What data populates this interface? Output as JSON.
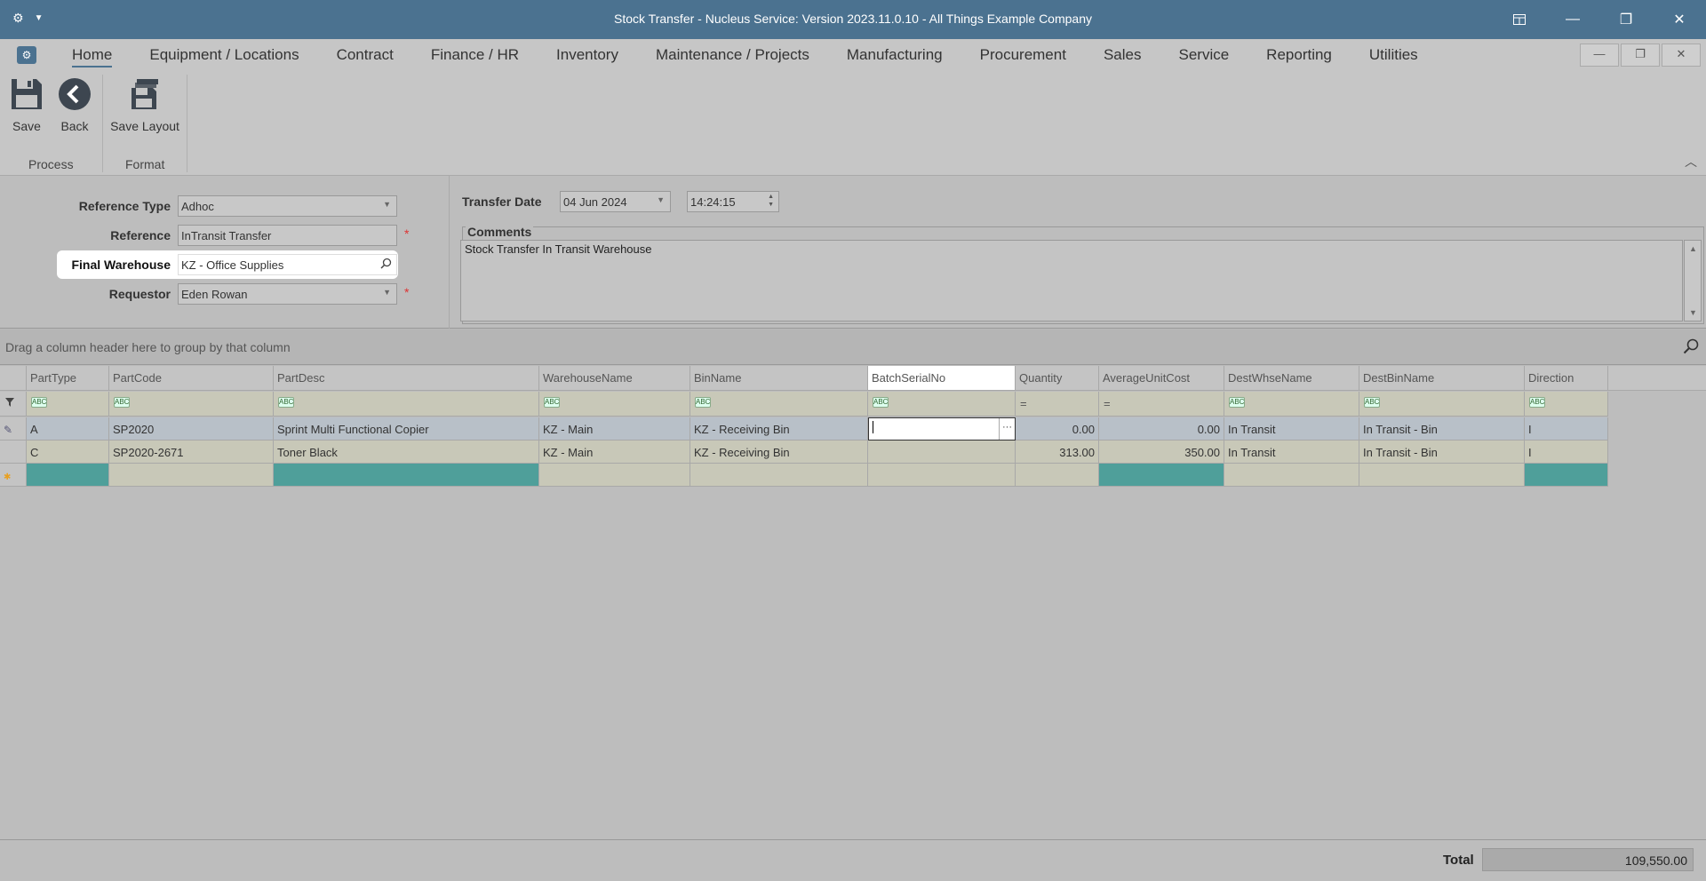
{
  "window": {
    "title": "Stock Transfer - Nucleus Service: Version 2023.11.0.10 - All Things Example Company"
  },
  "menu": {
    "tabs": [
      "Home",
      "Equipment / Locations",
      "Contract",
      "Finance / HR",
      "Inventory",
      "Maintenance / Projects",
      "Manufacturing",
      "Procurement",
      "Sales",
      "Service",
      "Reporting",
      "Utilities"
    ]
  },
  "ribbon": {
    "save_label": "Save",
    "back_label": "Back",
    "save_layout_label": "Save Layout",
    "group_process": "Process",
    "group_format": "Format"
  },
  "form": {
    "reference_type_label": "Reference Type",
    "reference_type_value": "Adhoc",
    "reference_label": "Reference",
    "reference_value": "InTransit Transfer",
    "final_warehouse_label": "Final Warehouse",
    "final_warehouse_value": "KZ - Office Supplies",
    "requestor_label": "Requestor",
    "requestor_value": "Eden Rowan",
    "required_mark": "*",
    "transfer_date_label": "Transfer Date",
    "transfer_date_value": "04 Jun 2024",
    "transfer_time_value": "14:24:15",
    "comments_label": "Comments",
    "comments_value": "Stock Transfer In Transit Warehouse"
  },
  "grid": {
    "group_hint": "Drag a column header here to group by that column",
    "columns": [
      "PartType",
      "PartCode",
      "PartDesc",
      "WarehouseName",
      "BinName",
      "BatchSerialNo",
      "Quantity",
      "AverageUnitCost",
      "DestWhseName",
      "DestBinName",
      "Direction"
    ],
    "rows": [
      {
        "PartType": "A",
        "PartCode": "SP2020",
        "PartDesc": "Sprint Multi Functional Copier",
        "WarehouseName": "KZ - Main",
        "BinName": "KZ - Receiving Bin",
        "BatchSerialNo": "",
        "Quantity": "0.00",
        "AverageUnitCost": "0.00",
        "DestWhseName": "In Transit",
        "DestBinName": "In Transit - Bin",
        "Direction": "I"
      },
      {
        "PartType": "C",
        "PartCode": "SP2020-2671",
        "PartDesc": "Toner Black",
        "WarehouseName": "KZ - Main",
        "BinName": "KZ - Receiving Bin",
        "BatchSerialNo": "",
        "Quantity": "313.00",
        "AverageUnitCost": "350.00",
        "DestWhseName": "In Transit",
        "DestBinName": "In Transit - Bin",
        "Direction": "I"
      }
    ]
  },
  "footer": {
    "total_label": "Total",
    "total_value": "109,550.00"
  }
}
